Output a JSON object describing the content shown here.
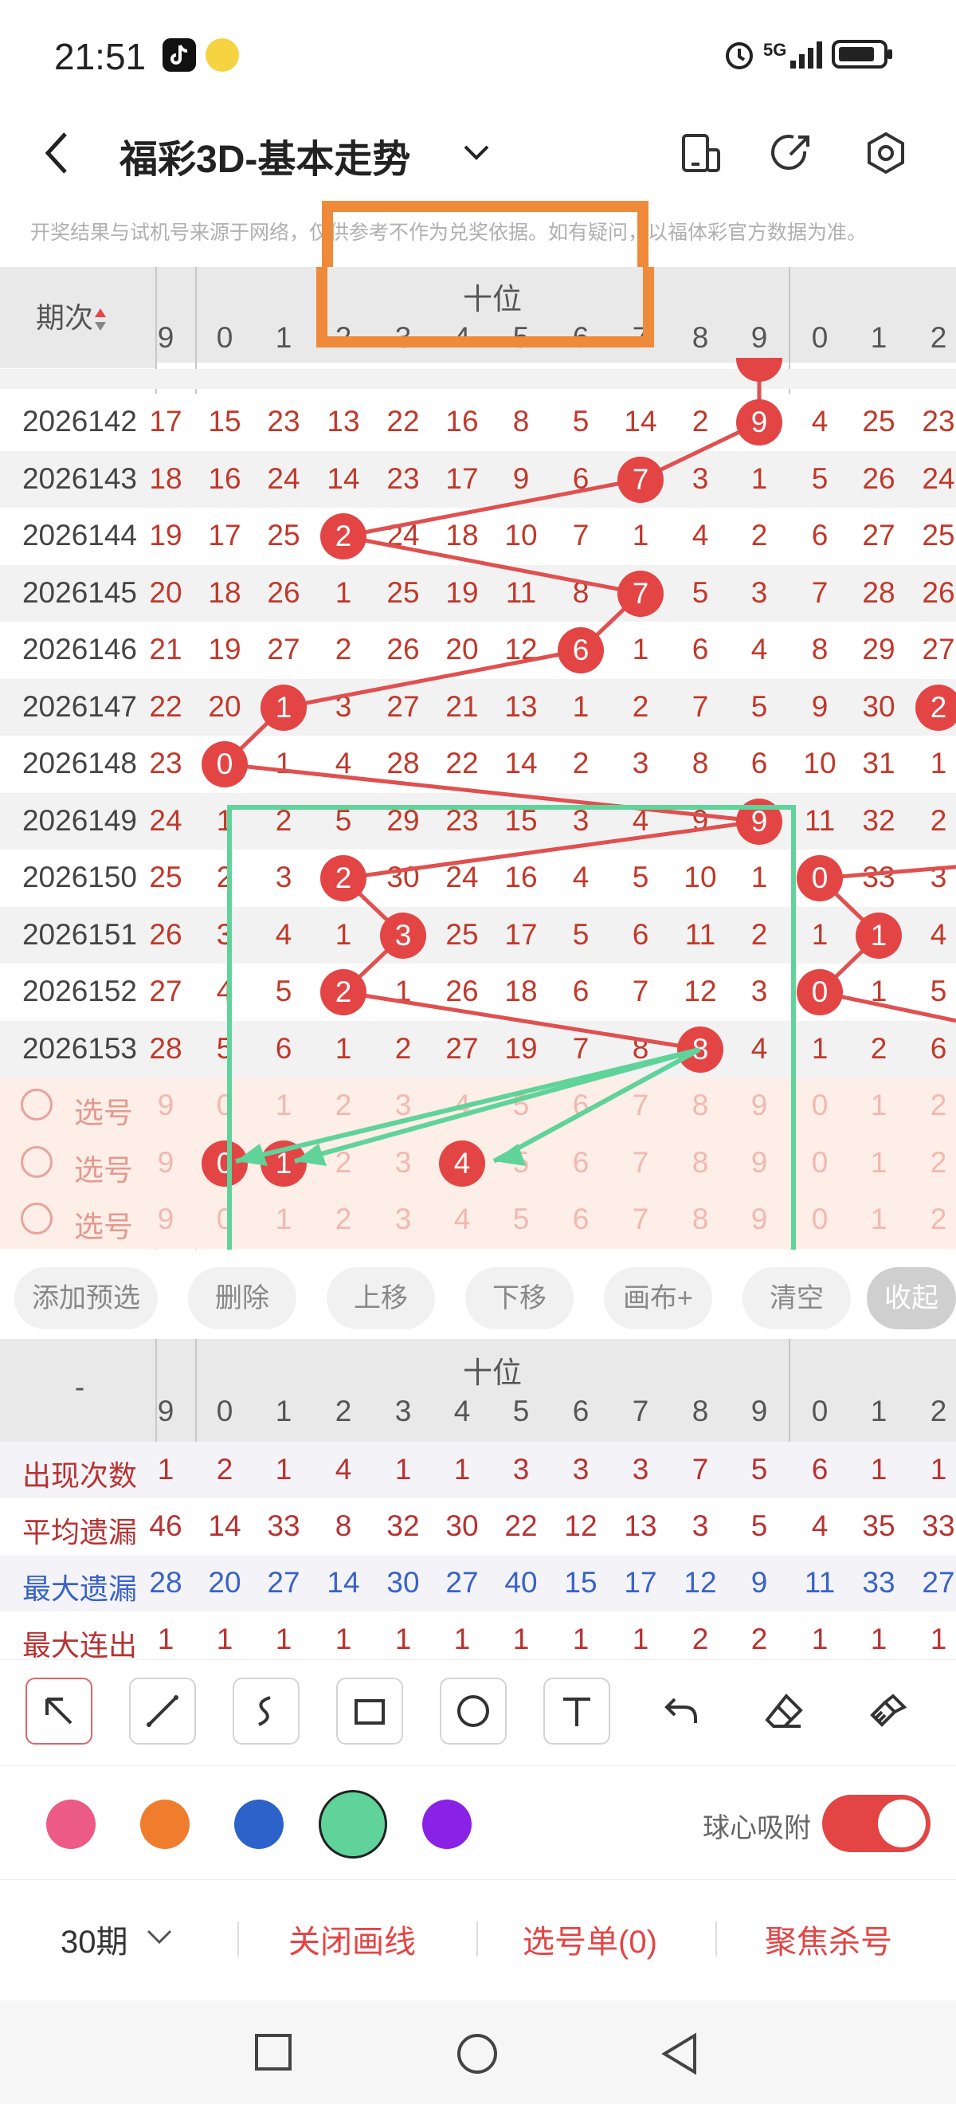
{
  "status_bar": {
    "time": "21:51",
    "network": "5G"
  },
  "header": {
    "title": "福彩3D-基本走势"
  },
  "notice": "开奖结果与试机号来源于网络，仅供参考不作为兑奖依据。如有疑问，以福体彩官方数据为准。",
  "table": {
    "period_header": "期次",
    "group_title": "十位",
    "columns": [
      "9",
      "0",
      "1",
      "2",
      "3",
      "4",
      "5",
      "6",
      "7",
      "8",
      "9",
      "0",
      "1",
      "2"
    ],
    "rows": [
      {
        "period": "2026142",
        "cells": [
          "17",
          "15",
          "23",
          "13",
          "22",
          "16",
          "8",
          "5",
          "14",
          "2",
          "9",
          "4",
          "25",
          "23"
        ]
      },
      {
        "period": "2026143",
        "cells": [
          "18",
          "16",
          "24",
          "14",
          "23",
          "17",
          "9",
          "6",
          "7",
          "3",
          "1",
          "5",
          "26",
          "24"
        ]
      },
      {
        "period": "2026144",
        "cells": [
          "19",
          "17",
          "25",
          "2",
          "24",
          "18",
          "10",
          "7",
          "1",
          "4",
          "2",
          "6",
          "27",
          "25"
        ]
      },
      {
        "period": "2026145",
        "cells": [
          "20",
          "18",
          "26",
          "1",
          "25",
          "19",
          "11",
          "8",
          "7",
          "5",
          "3",
          "7",
          "28",
          "26"
        ]
      },
      {
        "period": "2026146",
        "cells": [
          "21",
          "19",
          "27",
          "2",
          "26",
          "20",
          "12",
          "6",
          "1",
          "6",
          "4",
          "8",
          "29",
          "27"
        ]
      },
      {
        "period": "2026147",
        "cells": [
          "22",
          "20",
          "1",
          "3",
          "27",
          "21",
          "13",
          "1",
          "2",
          "7",
          "5",
          "9",
          "30",
          "2"
        ]
      },
      {
        "period": "2026148",
        "cells": [
          "23",
          "0",
          "1",
          "4",
          "28",
          "22",
          "14",
          "2",
          "3",
          "8",
          "6",
          "10",
          "31",
          "1"
        ]
      },
      {
        "period": "2026149",
        "cells": [
          "24",
          "1",
          "2",
          "5",
          "29",
          "23",
          "15",
          "3",
          "4",
          "9",
          "9",
          "11",
          "32",
          "2"
        ]
      },
      {
        "period": "2026150",
        "cells": [
          "25",
          "2",
          "3",
          "2",
          "30",
          "24",
          "16",
          "4",
          "5",
          "10",
          "1",
          "0",
          "33",
          "3"
        ]
      },
      {
        "period": "2026151",
        "cells": [
          "26",
          "3",
          "4",
          "1",
          "3",
          "25",
          "17",
          "5",
          "6",
          "11",
          "2",
          "1",
          "1",
          "4"
        ]
      },
      {
        "period": "2026152",
        "cells": [
          "27",
          "4",
          "5",
          "2",
          "1",
          "26",
          "18",
          "6",
          "7",
          "12",
          "3",
          "0",
          "1",
          "5"
        ]
      },
      {
        "period": "2026153",
        "cells": [
          "28",
          "5",
          "6",
          "1",
          "2",
          "27",
          "19",
          "7",
          "8",
          "8",
          "4",
          "1",
          "2",
          "6"
        ]
      }
    ],
    "pick_label": "选号",
    "pick_digits": [
      "9",
      "0",
      "1",
      "2",
      "3",
      "4",
      "5",
      "6",
      "7",
      "8",
      "9",
      "0",
      "1",
      "2"
    ],
    "pick_row2_balls": [
      "0",
      "1",
      "4"
    ]
  },
  "actions": [
    "添加预选",
    "删除",
    "上移",
    "下移",
    "画布+",
    "清空",
    "收起"
  ],
  "stats": {
    "dash": "-",
    "group_title": "十位",
    "columns": [
      "9",
      "0",
      "1",
      "2",
      "3",
      "4",
      "5",
      "6",
      "7",
      "8",
      "9",
      "0",
      "1",
      "2"
    ],
    "rows": [
      {
        "label": "出现次数",
        "color": "#b83232",
        "cells": [
          "1",
          "2",
          "1",
          "4",
          "1",
          "1",
          "3",
          "3",
          "3",
          "7",
          "5",
          "6",
          "1",
          "1"
        ]
      },
      {
        "label": "平均遗漏",
        "color": "#b83232",
        "cells": [
          "46",
          "14",
          "33",
          "8",
          "32",
          "30",
          "22",
          "12",
          "13",
          "3",
          "5",
          "4",
          "35",
          "33"
        ]
      },
      {
        "label": "最大遗漏",
        "color": "#3a62c7",
        "cells": [
          "28",
          "20",
          "27",
          "14",
          "30",
          "27",
          "40",
          "15",
          "17",
          "12",
          "9",
          "11",
          "33",
          "27"
        ]
      },
      {
        "label": "最大连出",
        "color": "#b83232",
        "cells": [
          "1",
          "1",
          "1",
          "1",
          "1",
          "1",
          "1",
          "1",
          "1",
          "2",
          "2",
          "1",
          "1",
          "1"
        ]
      }
    ]
  },
  "draw_colors": [
    "#ec5a86",
    "#ef7d2d",
    "#2c62c9",
    "#5fd39a",
    "#8a22e6"
  ],
  "magnet": {
    "label": "球心吸附",
    "on": true
  },
  "bottom_bar": {
    "periods": "30期",
    "close_draw": "关闭画线",
    "pick_list": "选号单(0)",
    "focus_kill": "聚焦杀号"
  },
  "colors": {
    "accent": "#e34545",
    "green": "#5fd39a",
    "orange": "#ef8a3a"
  }
}
